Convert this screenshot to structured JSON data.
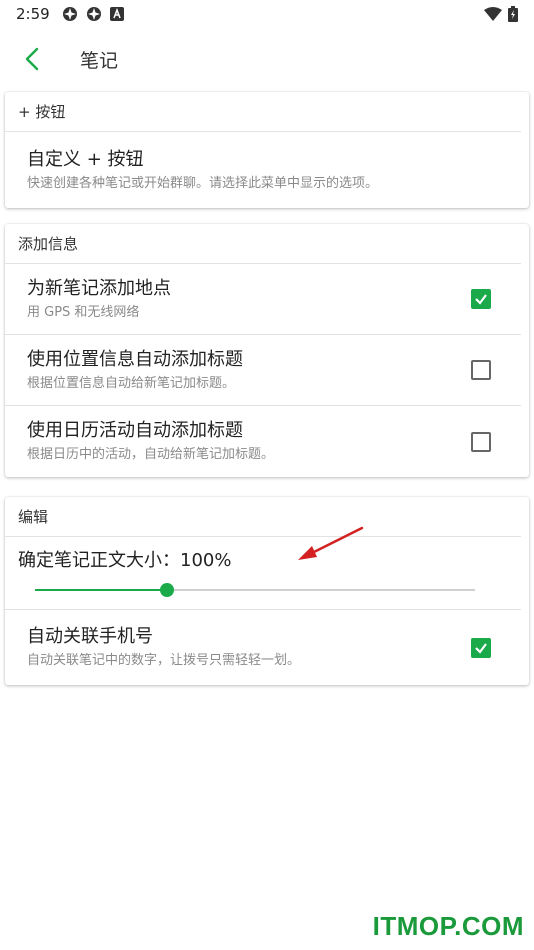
{
  "status_bar": {
    "time": "2:59",
    "icons_left": [
      "app-notification-icon",
      "app-notification-icon",
      "a-box-icon"
    ],
    "icons_right": [
      "wifi-icon",
      "battery-icon"
    ]
  },
  "app_bar": {
    "title": "笔记",
    "back_icon": "chevron-left-icon"
  },
  "accent_color": "#1aaa4a",
  "sections": {
    "plus_button": {
      "header": "+ 按钮",
      "item": {
        "title": "自定义 + 按钮",
        "subtitle": "快速创建各种笔记或开始群聊。请选择此菜单中显示的选项。"
      }
    },
    "add_info": {
      "header": "添加信息",
      "items": [
        {
          "title": "为新笔记添加地点",
          "subtitle": "用 GPS 和无线网络",
          "checked": true
        },
        {
          "title": "使用位置信息自动添加标题",
          "subtitle": "根据位置信息自动给新笔记加标题。",
          "checked": false
        },
        {
          "title": "使用日历活动自动添加标题",
          "subtitle": "根据日历中的活动，自动给新笔记加标题。",
          "checked": false
        }
      ]
    },
    "edit": {
      "header": "编辑",
      "font_size_label": "确定笔记正文大小：100%",
      "font_size_fraction": 0.3,
      "auto_link": {
        "title": "自动关联手机号",
        "subtitle": "自动关联笔记中的数字，让拨号只需轻轻一划。",
        "checked": true
      }
    }
  },
  "watermark": "ITMOP.COM"
}
